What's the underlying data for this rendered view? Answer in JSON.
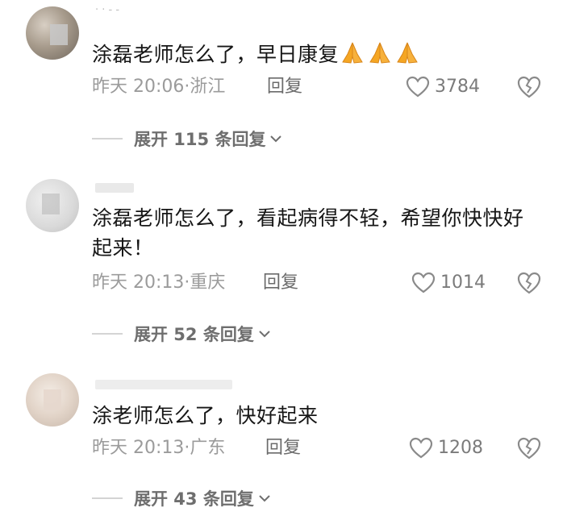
{
  "comments": [
    {
      "username": "· · - -",
      "text": "涂磊老师怎么了，早日康复",
      "emoji_count": 3,
      "time": "昨天 20:06",
      "location": "浙江",
      "reply_label": "回复",
      "likes": "3784",
      "expand_label": "展开 115 条回复"
    },
    {
      "username": "",
      "text": "涂磊老师怎么了，看起病得不轻，希望你快快好起来！",
      "time": "昨天 20:13",
      "location": "重庆",
      "reply_label": "回复",
      "likes": "1014",
      "expand_label": "展开 52 条回复"
    },
    {
      "username": "",
      "text": "涂老师怎么了，快好起来",
      "time": "昨天 20:13",
      "location": "广东",
      "reply_label": "回复",
      "likes": "1208",
      "expand_label": "展开 43 条回复"
    }
  ],
  "icons": {
    "like": "heart-outline-icon",
    "dislike": "broken-heart-icon",
    "expand": "chevron-down-icon",
    "emoji": "praying-hands-emoji"
  },
  "colors": {
    "text": "#161616",
    "meta": "#9b9b9b",
    "expand": "#6e6e6e",
    "emoji": "#f5a623"
  }
}
